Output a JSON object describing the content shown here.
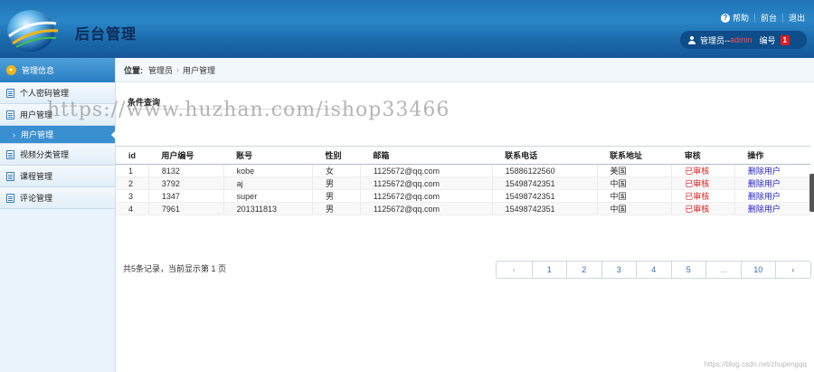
{
  "app": {
    "title": "后台管理"
  },
  "toplinks": {
    "help": "帮助",
    "frontend": "前台",
    "logout": "退出"
  },
  "user": {
    "prefix": "管理员--",
    "name": "admin",
    "num_label": "编号",
    "num": "1"
  },
  "sidebar": {
    "header": "管理信息",
    "items": [
      {
        "label": "个人密码管理"
      },
      {
        "label": "用户管理",
        "children": [
          {
            "label": "用户管理"
          }
        ]
      },
      {
        "label": "视频分类管理"
      },
      {
        "label": "课程管理"
      },
      {
        "label": "评论管理"
      }
    ]
  },
  "breadcrumb": {
    "prefix": "位置:",
    "items": [
      "管理员",
      "用户管理"
    ]
  },
  "section": {
    "title": "条件查询"
  },
  "watermark": "https://www.huzhan.com/ishop33466",
  "table": {
    "headers": [
      "id",
      "用户编号",
      "账号",
      "性别",
      "邮箱",
      "联系电话",
      "联系地址",
      "审核",
      "操作"
    ],
    "rows": [
      [
        "1",
        "8132",
        "kobe",
        "女",
        "1125672@qq.com",
        "15886122560",
        "美国",
        "已审核",
        "删除用户"
      ],
      [
        "2",
        "3792",
        "aj",
        "男",
        "1125672@qq.com",
        "15498742351",
        "中国",
        "已审核",
        "删除用户"
      ],
      [
        "3",
        "1347",
        "super",
        "男",
        "1125672@qq.com",
        "15498742351",
        "中国",
        "已审核",
        "删除用户"
      ],
      [
        "4",
        "7961",
        "201311813",
        "男",
        "1125672@qq.com",
        "15498742351",
        "中国",
        "已审核",
        "删除用户"
      ]
    ]
  },
  "footer": {
    "summary": "共5条记录，当前显示第  1 页"
  },
  "pager": {
    "prev": "‹",
    "pages": [
      "1",
      "2",
      "3",
      "4",
      "5",
      "...",
      "10"
    ],
    "next": "›"
  },
  "copyright": "https://blog.csdn.net/zhupengqq",
  "colors": {
    "header_blue": "#1f73b6",
    "accent_blue": "#3a8fd0",
    "status_red": "#e02020",
    "link_blue": "#2222cc"
  }
}
